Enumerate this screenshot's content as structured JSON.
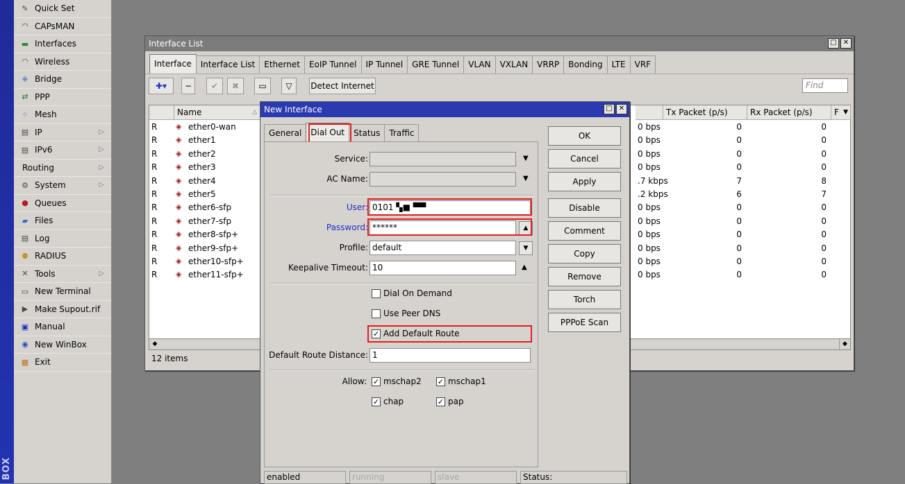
{
  "brand": "BOX",
  "sidebar": {
    "items": [
      {
        "label": "Quick Set",
        "icon": "wrench-icon",
        "arrow": false
      },
      {
        "label": "CAPsMAN",
        "icon": "capsman-icon",
        "arrow": false
      },
      {
        "label": "Interfaces",
        "icon": "interfaces-icon",
        "arrow": false
      },
      {
        "label": "Wireless",
        "icon": "wireless-icon",
        "arrow": false
      },
      {
        "label": "Bridge",
        "icon": "bridge-icon",
        "arrow": false
      },
      {
        "label": "PPP",
        "icon": "ppp-icon",
        "arrow": false
      },
      {
        "label": "Mesh",
        "icon": "mesh-icon",
        "arrow": false
      },
      {
        "label": "IP",
        "icon": "ip-icon",
        "arrow": true
      },
      {
        "label": "IPv6",
        "icon": "ipv6-icon",
        "arrow": true
      },
      {
        "label": "Routing",
        "icon": "",
        "arrow": true
      },
      {
        "label": "System",
        "icon": "gear-icon",
        "arrow": true
      },
      {
        "label": "Queues",
        "icon": "queues-icon",
        "arrow": false
      },
      {
        "label": "Files",
        "icon": "folder-icon",
        "arrow": false
      },
      {
        "label": "Log",
        "icon": "log-icon",
        "arrow": false
      },
      {
        "label": "RADIUS",
        "icon": "radius-icon",
        "arrow": false
      },
      {
        "label": "Tools",
        "icon": "tools-icon",
        "arrow": true
      },
      {
        "label": "New Terminal",
        "icon": "terminal-icon",
        "arrow": false
      },
      {
        "label": "Make Supout.rif",
        "icon": "supout-icon",
        "arrow": false
      },
      {
        "label": "Manual",
        "icon": "manual-icon",
        "arrow": false
      },
      {
        "label": "New WinBox",
        "icon": "winbox-icon",
        "arrow": false
      },
      {
        "label": "Exit",
        "icon": "exit-icon",
        "arrow": false
      }
    ]
  },
  "iface_window": {
    "title": "Interface List",
    "tabs": [
      "Interface",
      "Interface List",
      "Ethernet",
      "EoIP Tunnel",
      "IP Tunnel",
      "GRE Tunnel",
      "VLAN",
      "VXLAN",
      "VRRP",
      "Bonding",
      "LTE",
      "VRF"
    ],
    "detect_internet": "Detect Internet",
    "find_placeholder": "Find",
    "columns": {
      "name": "Name",
      "tx_bps": "",
      "tx_packet": "Tx Packet (p/s)",
      "rx_packet": "Rx Packet (p/s)",
      "f": "F"
    },
    "rows": [
      {
        "flag": "R",
        "name": "ether0-wan",
        "rate": "0 bps",
        "tx": "0",
        "rx": "0"
      },
      {
        "flag": "R",
        "name": "ether1",
        "rate": "0 bps",
        "tx": "0",
        "rx": "0"
      },
      {
        "flag": "R",
        "name": "ether2",
        "rate": "0 bps",
        "tx": "0",
        "rx": "0"
      },
      {
        "flag": "R",
        "name": "ether3",
        "rate": "0 bps",
        "tx": "0",
        "rx": "0"
      },
      {
        "flag": "R",
        "name": "ether4",
        "rate": ".7 kbps",
        "tx": "7",
        "rx": "8"
      },
      {
        "flag": "R",
        "name": "ether5",
        "rate": ".2 kbps",
        "tx": "6",
        "rx": "7"
      },
      {
        "flag": "R",
        "name": "ether6-sfp",
        "rate": "0 bps",
        "tx": "0",
        "rx": "0"
      },
      {
        "flag": "R",
        "name": "ether7-sfp",
        "rate": "0 bps",
        "tx": "0",
        "rx": "0"
      },
      {
        "flag": "R",
        "name": "ether8-sfp+",
        "rate": "0 bps",
        "tx": "0",
        "rx": "0"
      },
      {
        "flag": "R",
        "name": "ether9-sfp+",
        "rate": "0 bps",
        "tx": "0",
        "rx": "0"
      },
      {
        "flag": "R",
        "name": "ether10-sfp+",
        "rate": "0 bps",
        "tx": "0",
        "rx": "0"
      },
      {
        "flag": "R",
        "name": "ether11-sfp+",
        "rate": "0 bps",
        "tx": "0",
        "rx": "0"
      }
    ],
    "items_count": "12 items"
  },
  "dialog": {
    "title": "New Interface",
    "tabs": [
      "General",
      "Dial Out",
      "Status",
      "Traffic"
    ],
    "active_tab": "Dial Out",
    "fields": {
      "service_label": "Service:",
      "service_value": "",
      "ac_name_label": "AC Name:",
      "ac_name_value": "",
      "user_label": "User:",
      "user_value": "0101 ▚■ ▀▀",
      "password_label": "Password:",
      "password_value": "******",
      "profile_label": "Profile:",
      "profile_value": "default",
      "keepalive_label": "Keepalive Timeout:",
      "keepalive_value": "10",
      "default_route_distance_label": "Default Route Distance:",
      "default_route_distance_value": "1",
      "allow_label": "Allow:"
    },
    "checks": {
      "dial_on_demand": {
        "label": "Dial On Demand",
        "checked": false
      },
      "use_peer_dns": {
        "label": "Use Peer DNS",
        "checked": false
      },
      "add_default_route": {
        "label": "Add Default Route",
        "checked": true
      },
      "mschap2": {
        "label": "mschap2",
        "checked": true
      },
      "mschap1": {
        "label": "mschap1",
        "checked": true
      },
      "chap": {
        "label": "chap",
        "checked": true
      },
      "pap": {
        "label": "pap",
        "checked": true
      }
    },
    "buttons": [
      "OK",
      "Cancel",
      "Apply",
      "Disable",
      "Comment",
      "Copy",
      "Remove",
      "Torch",
      "PPPoE Scan"
    ],
    "status": {
      "enabled": "enabled",
      "running": "running",
      "slave": "slave",
      "status": "Status:"
    }
  },
  "colors": {
    "highlight": "#e01e1e",
    "dialog_title": "#2b3ab0",
    "label_blue": "#1c2fc8"
  }
}
